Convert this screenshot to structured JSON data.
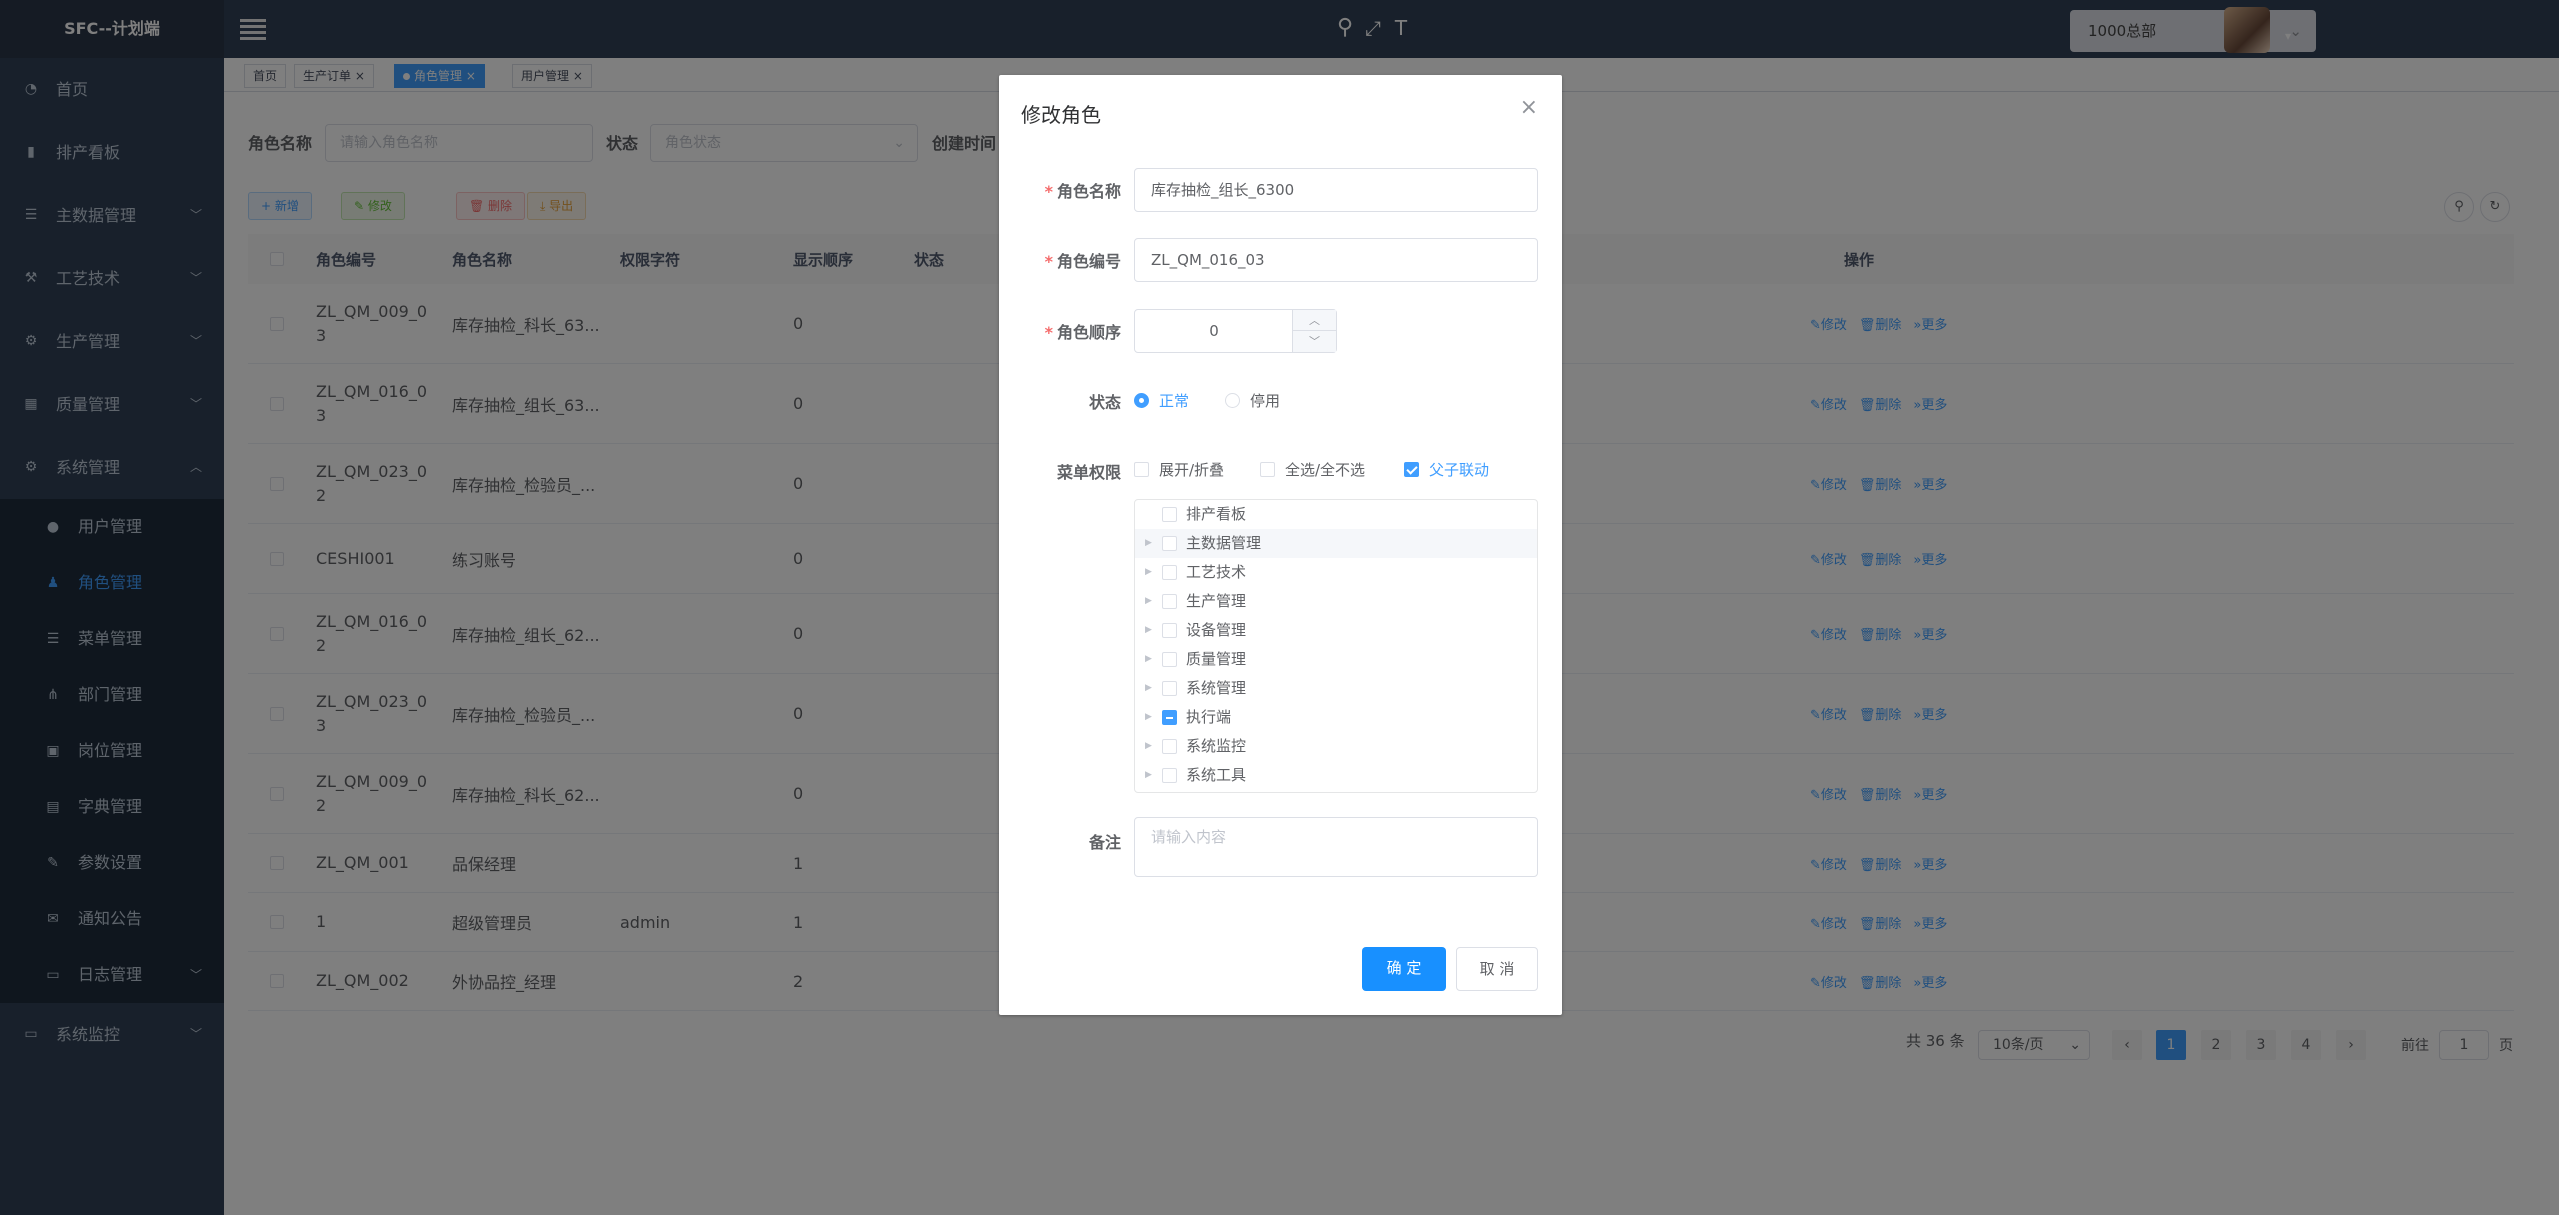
{
  "app_title": "SFC--计划端",
  "colors": {
    "sidebar": "#304156",
    "accent": "#409eff",
    "danger": "#f56c6c",
    "success": "#67c23a",
    "warning": "#e6a23c"
  },
  "sidebar": {
    "items": [
      {
        "label": "首页",
        "icon": "dashboard-icon"
      },
      {
        "label": "排产看板",
        "icon": "bar-chart-icon"
      },
      {
        "label": "主数据管理",
        "icon": "list-icon",
        "has_children": true
      },
      {
        "label": "工艺技术",
        "icon": "tools-icon",
        "has_children": true
      },
      {
        "label": "生产管理",
        "icon": "production-icon",
        "has_children": true
      },
      {
        "label": "质量管理",
        "icon": "quality-icon",
        "has_children": true
      },
      {
        "label": "系统管理",
        "icon": "gear-icon",
        "has_children": true,
        "expanded": true
      }
    ],
    "sub_items": [
      {
        "label": "用户管理",
        "icon": "user-icon"
      },
      {
        "label": "角色管理",
        "icon": "peoples-icon",
        "active": true
      },
      {
        "label": "菜单管理",
        "icon": "tree-table-icon"
      },
      {
        "label": "部门管理",
        "icon": "tree-icon"
      },
      {
        "label": "岗位管理",
        "icon": "post-icon"
      },
      {
        "label": "字典管理",
        "icon": "dict-icon"
      },
      {
        "label": "参数设置",
        "icon": "edit-icon"
      },
      {
        "label": "通知公告",
        "icon": "message-icon"
      },
      {
        "label": "日志管理",
        "icon": "log-icon",
        "has_children": true
      }
    ],
    "after_items": [
      {
        "label": "系统监控",
        "icon": "monitor-icon",
        "has_children": true
      }
    ]
  },
  "header": {
    "org_select": "1000总部"
  },
  "tags": [
    "首页",
    "生产订单",
    "角色管理",
    "用户管理"
  ],
  "search": {
    "role_name_label": "角色名称",
    "role_name_placeholder": "请输入角色名称",
    "status_label": "状态",
    "status_placeholder": "角色状态",
    "created_label": "创建时间"
  },
  "toolbar": {
    "add": "+ 新增",
    "edit": "✎ 修改",
    "delete": "🗑 删除",
    "export": "⤓ 导出"
  },
  "table": {
    "columns": [
      "角色编号",
      "角色名称",
      "权限字符",
      "显示顺序",
      "状态",
      "操作"
    ],
    "rows": [
      {
        "code": [
          "ZL_QM_009_0",
          "3"
        ],
        "name": "库存抽检_科长_63...",
        "perm": "",
        "order": "0"
      },
      {
        "code": [
          "ZL_QM_016_0",
          "3"
        ],
        "name": "库存抽检_组长_63...",
        "perm": "",
        "order": "0"
      },
      {
        "code": [
          "ZL_QM_023_0",
          "2"
        ],
        "name": "库存抽检_检验员_...",
        "perm": "",
        "order": "0"
      },
      {
        "code": [
          "CESHI001",
          ""
        ],
        "name": "练习账号",
        "perm": "",
        "order": "0"
      },
      {
        "code": [
          "ZL_QM_016_0",
          "2"
        ],
        "name": "库存抽检_组长_62...",
        "perm": "",
        "order": "0"
      },
      {
        "code": [
          "ZL_QM_023_0",
          "3"
        ],
        "name": "库存抽检_检验员_...",
        "perm": "",
        "order": "0"
      },
      {
        "code": [
          "ZL_QM_009_0",
          "2"
        ],
        "name": "库存抽检_科长_62...",
        "perm": "",
        "order": "0"
      },
      {
        "code": [
          "ZL_QM_001",
          ""
        ],
        "name": "品保经理",
        "perm": "",
        "order": "1"
      },
      {
        "code": [
          "1",
          ""
        ],
        "name": "超级管理员",
        "perm": "admin",
        "order": "1"
      },
      {
        "code": [
          "ZL_QM_002",
          ""
        ],
        "name": "外协品控_经理",
        "perm": "",
        "order": "2"
      }
    ],
    "ops": {
      "edit": "✎修改",
      "delete": "🗑删除",
      "more": "»更多"
    }
  },
  "pagination": {
    "total": "共 36 条",
    "page_size": "10条/页",
    "pages": [
      "1",
      "2",
      "3",
      "4"
    ],
    "current": "1",
    "goto_label": "前往",
    "goto_value": "1",
    "page_suffix": "页"
  },
  "dialog": {
    "title": "修改角色",
    "close": "×",
    "role_name_label": "角色名称",
    "role_name_value": "库存抽检_组长_6300",
    "role_code_label": "角色编号",
    "role_code_value": "ZL_QM_016_03",
    "role_order_label": "角色顺序",
    "role_order_value": "0",
    "status_label": "状态",
    "status_options": [
      "正常",
      "停用"
    ],
    "status_selected": "正常",
    "menu_perm_label": "菜单权限",
    "menu_options": {
      "expand": "展开/折叠",
      "select_all": "全选/全不选",
      "linkage": "父子联动"
    },
    "tree": [
      {
        "label": "排产看板",
        "expandable": false,
        "state": "unchecked"
      },
      {
        "label": "主数据管理",
        "expandable": true,
        "state": "unchecked"
      },
      {
        "label": "工艺技术",
        "expandable": true,
        "state": "unchecked"
      },
      {
        "label": "生产管理",
        "expandable": true,
        "state": "unchecked"
      },
      {
        "label": "设备管理",
        "expandable": true,
        "state": "unchecked"
      },
      {
        "label": "质量管理",
        "expandable": true,
        "state": "unchecked"
      },
      {
        "label": "系统管理",
        "expandable": true,
        "state": "unchecked"
      },
      {
        "label": "执行端",
        "expandable": true,
        "state": "indeterminate"
      },
      {
        "label": "系统监控",
        "expandable": true,
        "state": "unchecked"
      },
      {
        "label": "系统工具",
        "expandable": true,
        "state": "unchecked"
      }
    ],
    "remark_label": "备注",
    "remark_placeholder": "请输入内容",
    "confirm": "确 定",
    "cancel": "取 消"
  }
}
